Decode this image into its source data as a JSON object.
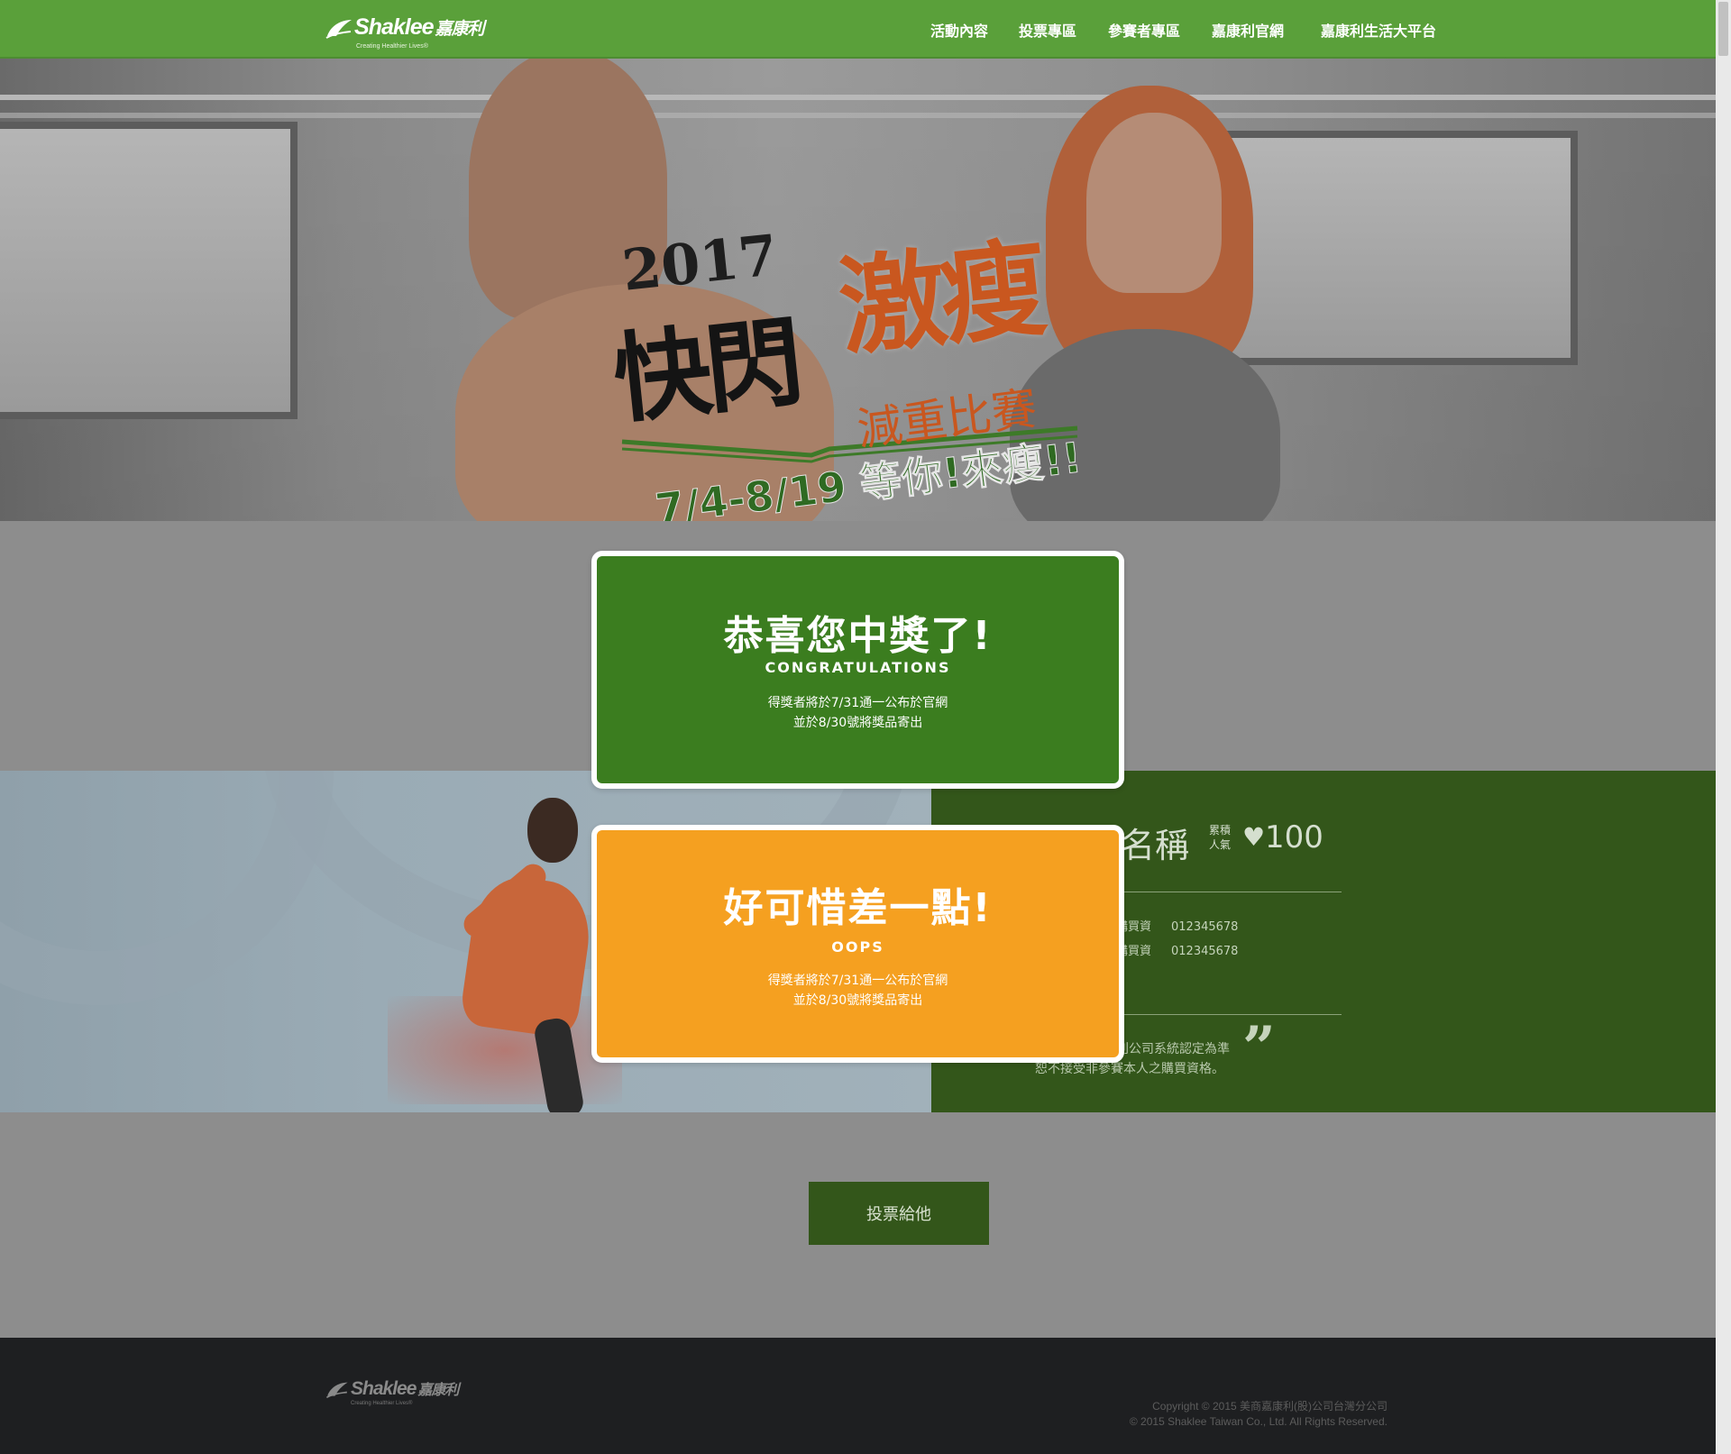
{
  "brand": {
    "name": "Shaklee",
    "name_cn": "嘉康利",
    "tagline": "Creating Healthier Lives®"
  },
  "nav": {
    "items": [
      {
        "label": "活動內容"
      },
      {
        "label": "投票專區"
      },
      {
        "label": "參賽者專區"
      },
      {
        "label": "嘉康利官網"
      },
      {
        "label": "嘉康利生活大平台"
      }
    ]
  },
  "hero": {
    "year": "2017",
    "title_main": "快閃",
    "title_accent": "激瘦",
    "subtitle": "減重比賽",
    "dates": "7/4-8/19 等你!來瘦!!"
  },
  "contestant": {
    "name": "名稱",
    "popularity_label": "累積人氣",
    "votes": "100",
    "lines": [
      {
        "label": "購買資",
        "value": "012345678"
      },
      {
        "label": "購買資",
        "value": "012345678"
      }
    ],
    "note_line1": "利公司系統認定為準",
    "note_line2": "恕不接受非參賽本人之購買資格。",
    "quote_open": "“",
    "quote_close": "”"
  },
  "vote_button": {
    "label": "投票給他"
  },
  "result_win": {
    "title": "恭喜您中獎了!",
    "subtitle": "CONGRATULATIONS",
    "line1": "得獎者將於7/31通一公布於官網",
    "line2": "並於8/30號將獎品寄出"
  },
  "result_lose": {
    "title": "好可惜差一點!",
    "subtitle": "OOPS",
    "line1": "得獎者將於7/31通一公布於官網",
    "line2": "並於8/30號將獎品寄出"
  },
  "footer": {
    "copyright_cn": "Copyright © 2015 美商嘉康利(股)公司台灣分公司",
    "copyright_en": "© 2015 Shaklee Taiwan Co., Ltd. All Rights Reserved."
  },
  "colors": {
    "header_green": "#5aa03a",
    "dark_green": "#33561a",
    "win_green": "#3b7d1f",
    "lose_orange": "#f5a020",
    "accent_orange": "#c9571f"
  }
}
